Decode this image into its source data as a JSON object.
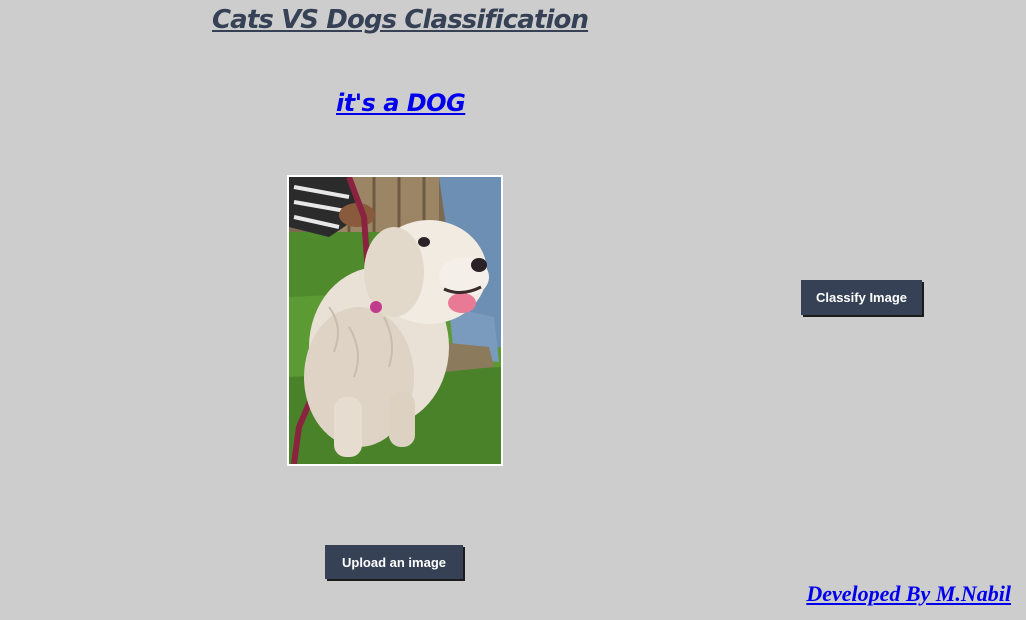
{
  "app": {
    "title": "Cats VS Dogs Classification",
    "result": "it's a DOG",
    "credit": "Developed By M.Nabil"
  },
  "image": {
    "subject": "white dog on grass"
  },
  "buttons": {
    "upload_label": "Upload an image",
    "classify_label": "Classify Image"
  },
  "colors": {
    "background": "#cdcdcd",
    "title": "#364156",
    "button_bg": "#364156",
    "button_text": "#ffffff",
    "link": "#0000ee",
    "image_border": "#ffffff"
  }
}
